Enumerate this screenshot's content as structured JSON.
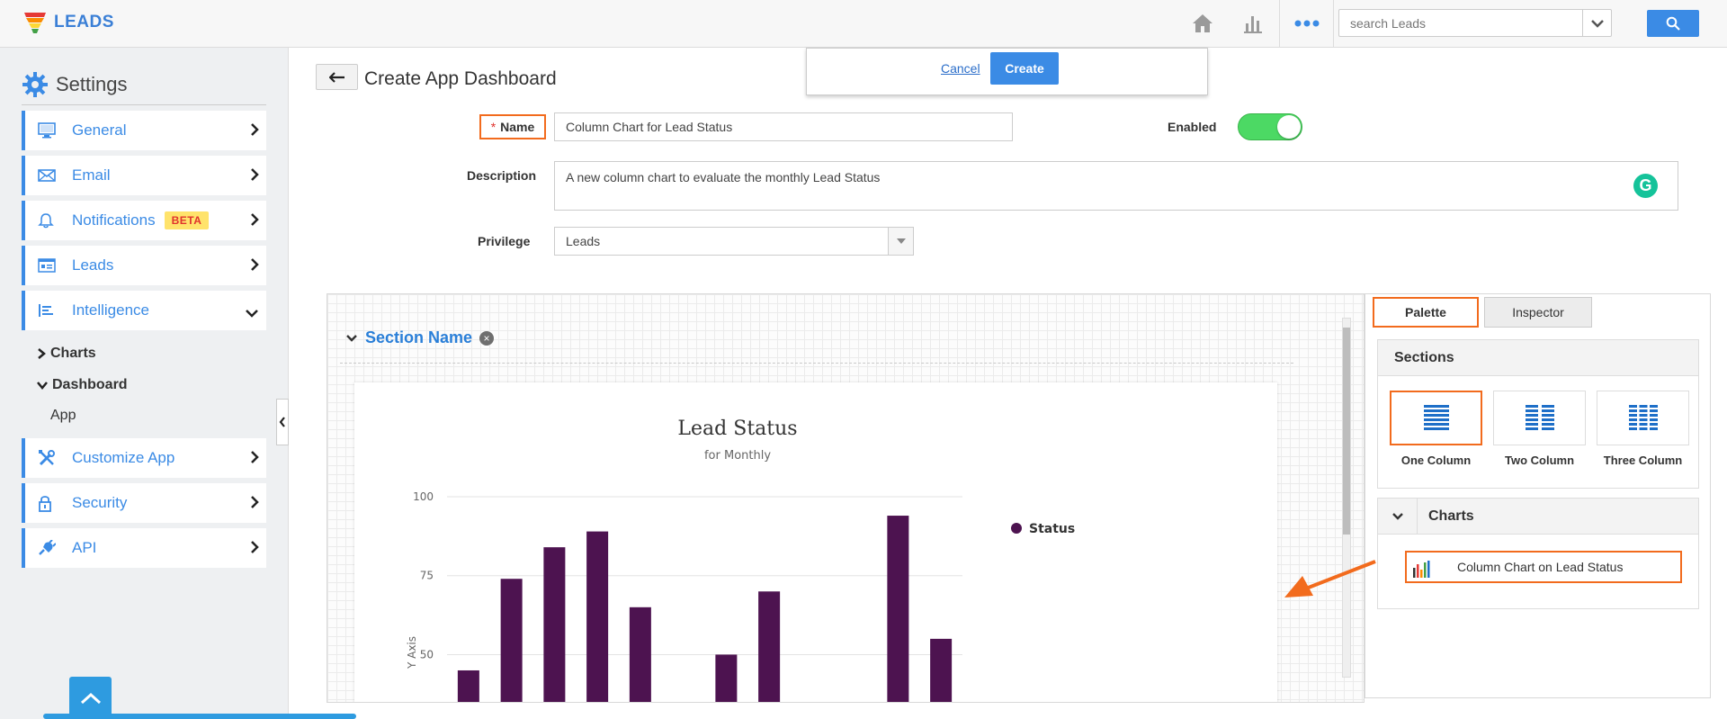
{
  "app": {
    "name": "LEADS"
  },
  "topbar": {
    "search_placeholder": "search Leads"
  },
  "sidebar": {
    "title": "Settings",
    "items": [
      {
        "label": "General",
        "icon": "monitor-icon"
      },
      {
        "label": "Email",
        "icon": "envelope-icon"
      },
      {
        "label": "Notifications",
        "icon": "bell-icon",
        "badge": "BETA"
      },
      {
        "label": "Leads",
        "icon": "leads-list-icon"
      },
      {
        "label": "Intelligence",
        "icon": "intelligence-icon",
        "expanded": true
      },
      {
        "label": "Customize App",
        "icon": "tools-icon"
      },
      {
        "label": "Security",
        "icon": "lock-icon"
      },
      {
        "label": "API",
        "icon": "plug-icon"
      }
    ],
    "sub_items": [
      {
        "label": "Charts"
      },
      {
        "label": "Dashboard"
      },
      {
        "label": "App"
      }
    ]
  },
  "page": {
    "title": "Create App Dashboard"
  },
  "dialog": {
    "cancel": "Cancel",
    "create": "Create"
  },
  "form": {
    "required_mark": "*",
    "name_label": "Name",
    "name_value": "Column Chart for Lead Status",
    "enabled_label": "Enabled",
    "enabled": true,
    "description_label": "Description",
    "description_value": "A new column chart to evaluate the monthly Lead Status",
    "privilege_label": "Privilege",
    "privilege_value": "Leads"
  },
  "canvas": {
    "section_name": "Section Name"
  },
  "chart_data": {
    "type": "bar",
    "title": "Lead Status",
    "subtitle": "for Monthly",
    "ylabel": "Y Axis",
    "yticks": [
      100,
      75,
      50
    ],
    "ylim_visible": [
      43,
      100
    ],
    "series": [
      {
        "name": "Status",
        "color": "#4d1350",
        "values": [
          45,
          74,
          84,
          89,
          65,
          null,
          50,
          70,
          null,
          null,
          94,
          55
        ]
      }
    ],
    "legend_position": "right"
  },
  "palette": {
    "tabs": [
      "Palette",
      "Inspector"
    ],
    "sections_title": "Sections",
    "section_options": [
      "One Column",
      "Two Column",
      "Three Column"
    ],
    "charts_title": "Charts",
    "chart_item": "Column Chart on Lead Status"
  },
  "colors": {
    "accent": "#3b8be5",
    "highlight": "#f26b1d",
    "bar": "#4d1350",
    "toggle_on": "#4cd964"
  }
}
